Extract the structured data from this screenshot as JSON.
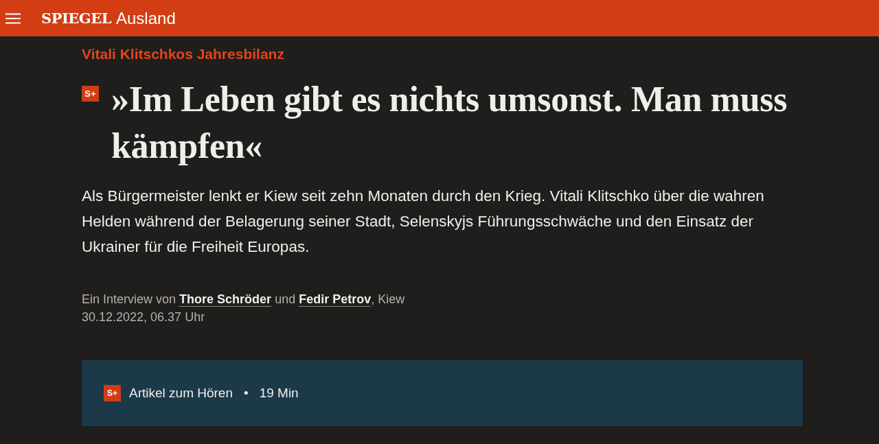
{
  "header": {
    "brand": "SPIEGEL",
    "section": "Ausland"
  },
  "article": {
    "kicker": "Vitali Klitschkos Jahresbilanz",
    "badge": "S+",
    "headline": "»Im Leben gibt es nichts umsonst. Man muss kämpfen«",
    "lead": "Als Bürgermeister lenkt er Kiew seit zehn Monaten durch den Krieg. Vitali Klitschko über die wahren Helden während der Belagerung seiner Stadt, Selenskyjs Führungsschwäche und den Einsatz der Ukrainer für die Freiheit Europas.",
    "byline": {
      "prefix": "Ein Interview von",
      "authors": [
        "Thore Schröder",
        "Fedir Petrov"
      ],
      "joiner": "und",
      "suffix": ", Kiew"
    },
    "date": "30.12.2022, 06.37 Uhr"
  },
  "audio": {
    "badge": "S+",
    "label": "Artikel zum Hören",
    "separator": "•",
    "duration": "19 Min"
  }
}
